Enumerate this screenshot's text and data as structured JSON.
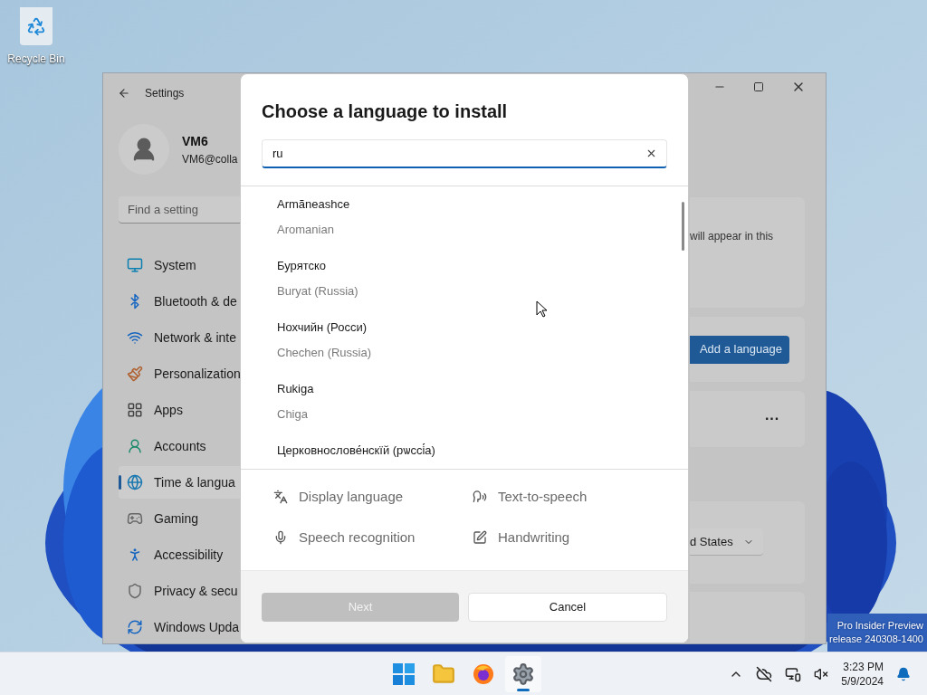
{
  "desktop": {
    "icons": [
      {
        "label": "Recycle Bin"
      }
    ],
    "watermark": [
      "Pro Insider Preview",
      "release 240308-1400"
    ]
  },
  "settings_window": {
    "title": "Settings",
    "user": {
      "name": "VM6",
      "email": "VM6@colla"
    },
    "search": {
      "placeholder": "Find a setting"
    },
    "nav": [
      {
        "label": "System",
        "selected": false
      },
      {
        "label": "Bluetooth & de",
        "selected": false
      },
      {
        "label": "Network & inte",
        "selected": false
      },
      {
        "label": "Personalization",
        "selected": false
      },
      {
        "label": "Apps",
        "selected": false
      },
      {
        "label": "Accounts",
        "selected": false
      },
      {
        "label": "Time & langua",
        "selected": true
      },
      {
        "label": "Gaming",
        "selected": false
      },
      {
        "label": "Accessibility",
        "selected": false
      },
      {
        "label": "Privacy & secu",
        "selected": false
      },
      {
        "label": "Windows Upda",
        "selected": false
      }
    ],
    "content": {
      "card_text": "will appear in this",
      "add_button": "Add a language",
      "more": "···",
      "dropdown": "d States"
    }
  },
  "dialog": {
    "title": "Choose a language to install",
    "search": {
      "value": "ru"
    },
    "languages": [
      {
        "native": "Armãneashce",
        "english": "Aromanian"
      },
      {
        "native": "Бурятско",
        "english": "Buryat (Russia)"
      },
      {
        "native": "Нохчийн (Росси)",
        "english": "Chechen (Russia)"
      },
      {
        "native": "Rukiga",
        "english": "Chiga"
      },
      {
        "native": "Церковнослове́нскїй (рѡссі́а)"
      }
    ],
    "features": [
      {
        "label": "Display language"
      },
      {
        "label": "Text-to-speech"
      },
      {
        "label": "Speech recognition"
      },
      {
        "label": "Handwriting"
      }
    ],
    "buttons": {
      "next": {
        "label": "Next",
        "disabled": true
      },
      "cancel": {
        "label": "Cancel"
      }
    }
  },
  "taskbar": {
    "apps": [
      {
        "selected": false
      },
      {
        "selected": false
      },
      {
        "selected": false
      },
      {
        "selected": true
      }
    ],
    "time": "3:23 PM",
    "date": "5/9/2024"
  }
}
